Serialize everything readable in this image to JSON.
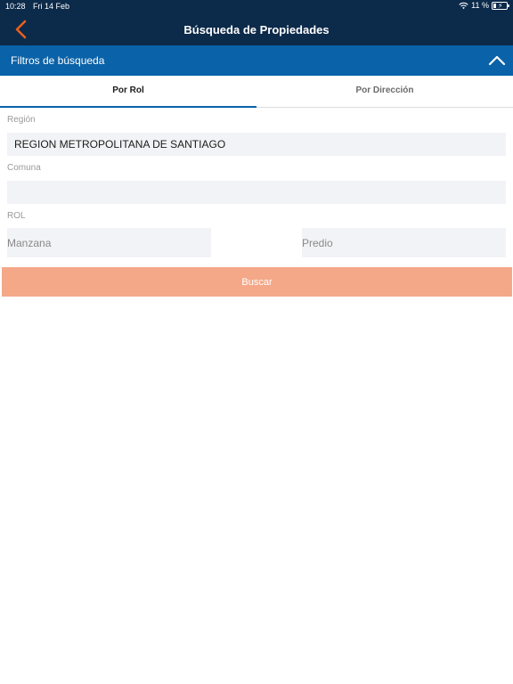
{
  "status_bar": {
    "time": "10:28",
    "date": "Fri 14 Feb",
    "battery": "11 %"
  },
  "nav": {
    "title": "Búsqueda de Propiedades"
  },
  "filters": {
    "label": "Filtros de búsqueda"
  },
  "tabs": [
    {
      "label": "Por Rol",
      "active": true
    },
    {
      "label": "Por Dirección",
      "active": false
    }
  ],
  "form": {
    "region_label": "Región",
    "region_value": "REGION METROPOLITANA DE SANTIAGO",
    "comuna_label": "Comuna",
    "comuna_value": "",
    "rol_label": "ROL",
    "manzana_placeholder": "Manzana",
    "predio_placeholder": "Predio"
  },
  "actions": {
    "search_label": "Buscar"
  },
  "colors": {
    "nav_bg": "#0c2a4a",
    "filters_bg": "#0a62a8",
    "accent_back": "#e8601c",
    "button_bg": "#f4a888"
  }
}
